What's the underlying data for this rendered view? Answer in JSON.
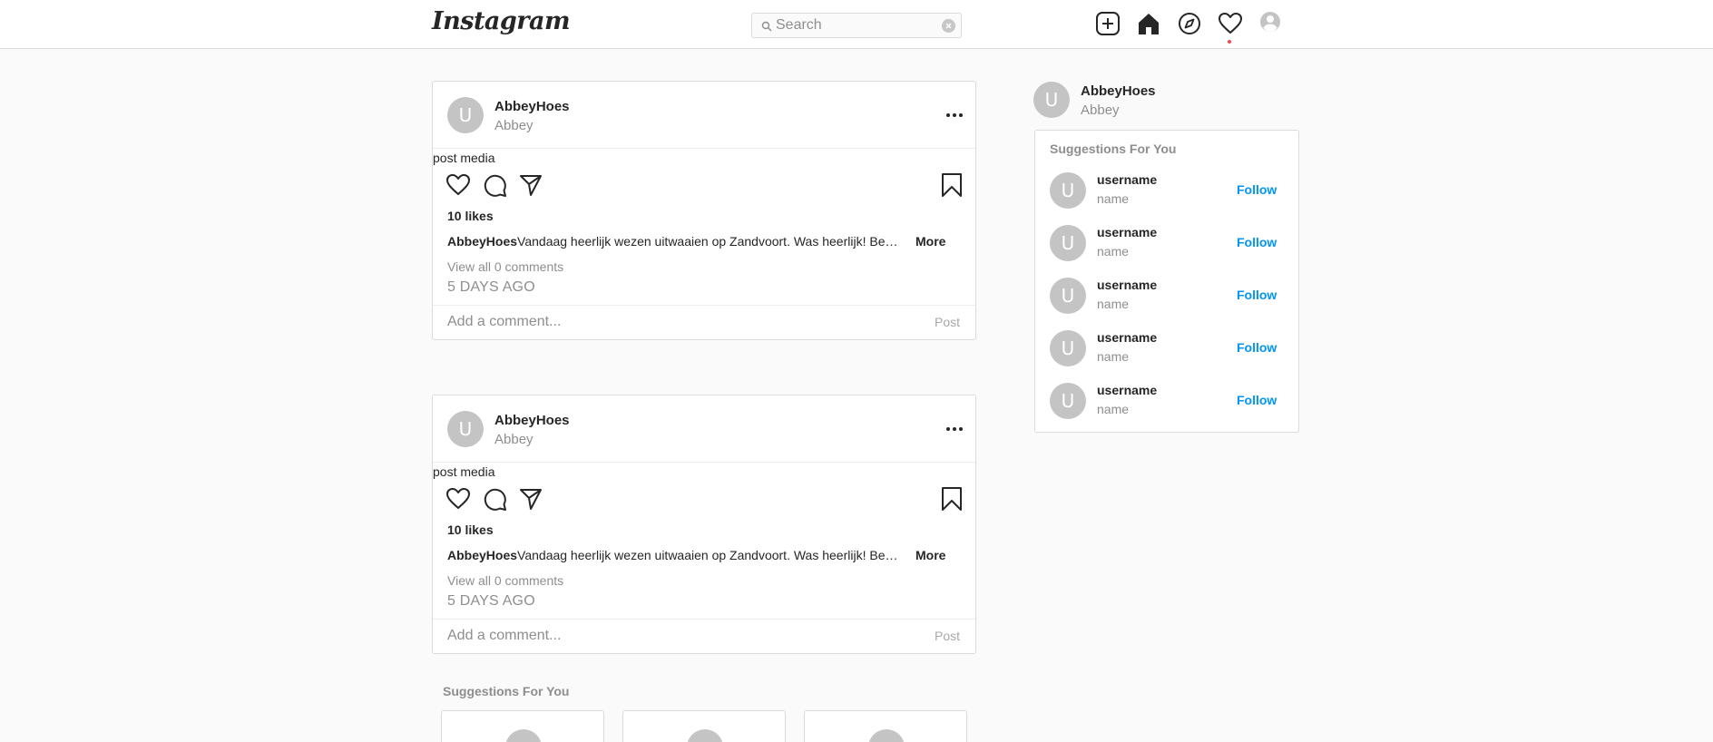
{
  "header": {
    "logo_text": "Instagram",
    "search": {
      "placeholder": "Search",
      "value": ""
    },
    "icons": [
      "new-post-icon",
      "home-icon",
      "explore-icon",
      "activity-heart-icon",
      "profile-icon"
    ],
    "notification_dot_color": "#ed4956"
  },
  "posts": [
    {
      "avatar_letter": "U",
      "username": "AbbeyHoes",
      "name": "Abbey",
      "media_alt": "post media",
      "likes": "10 likes",
      "caption_user": "AbbeyHoes",
      "caption_text": "Vandaag heerlijk wezen uitwaaien op Zandvoort. Was heerlijk! Ben ji...",
      "more_label": "More",
      "view_comments": "View all 0 comments",
      "time_ago": "5 DAYS AGO",
      "comment_placeholder": "Add a comment...",
      "post_label": "Post"
    },
    {
      "avatar_letter": "U",
      "username": "AbbeyHoes",
      "name": "Abbey",
      "media_alt": "post media",
      "likes": "10 likes",
      "caption_user": "AbbeyHoes",
      "caption_text": "Vandaag heerlijk wezen uitwaaien op Zandvoort. Was heerlijk! Ben ji...",
      "more_label": "More",
      "view_comments": "View all 0 comments",
      "time_ago": "5 DAYS AGO",
      "comment_placeholder": "Add a comment...",
      "post_label": "Post"
    }
  ],
  "sidebar": {
    "me": {
      "avatar_letter": "U",
      "username": "AbbeyHoes",
      "name": "Abbey"
    },
    "suggestions_title": "Suggestions For You",
    "suggestions": [
      {
        "avatar_letter": "U",
        "username": "username",
        "name": "name",
        "follow_label": "Follow"
      },
      {
        "avatar_letter": "U",
        "username": "username",
        "name": "name",
        "follow_label": "Follow"
      },
      {
        "avatar_letter": "U",
        "username": "username",
        "name": "name",
        "follow_label": "Follow"
      },
      {
        "avatar_letter": "U",
        "username": "username",
        "name": "name",
        "follow_label": "Follow"
      },
      {
        "avatar_letter": "U",
        "username": "username",
        "name": "name",
        "follow_label": "Follow"
      }
    ]
  },
  "bottom_suggestions": {
    "title": "Suggestions For You"
  },
  "colors": {
    "accent": "#0095f6",
    "border": "#dbdbdb",
    "muted": "#8e8e8e",
    "avatar": "#c4c4c4"
  }
}
